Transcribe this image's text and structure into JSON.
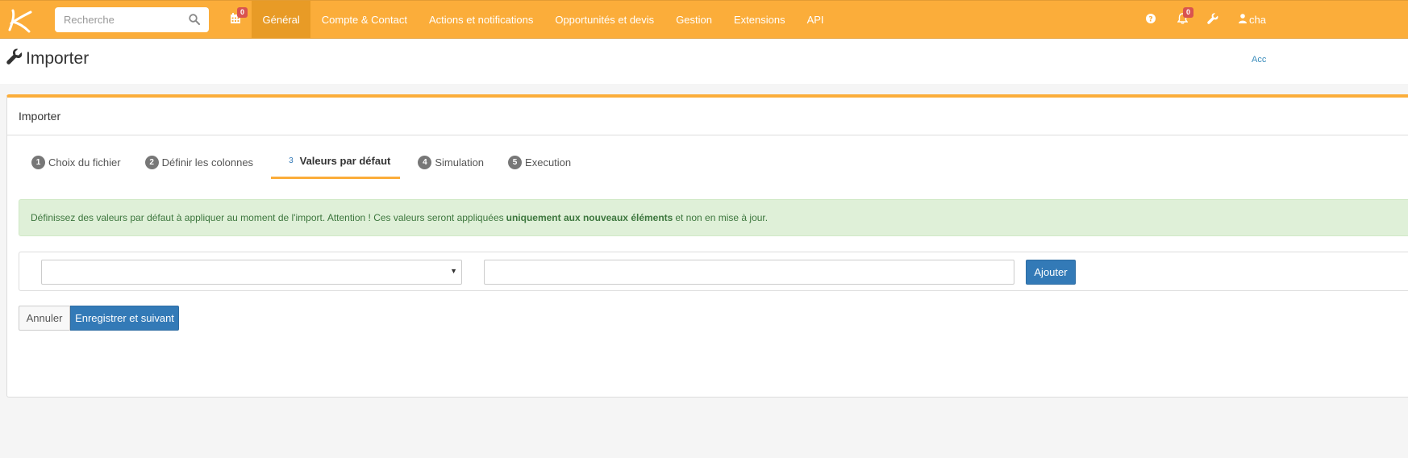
{
  "search": {
    "placeholder": "Recherche"
  },
  "navbar": {
    "calendar_badge": "0",
    "notifications_badge": "0",
    "items": [
      {
        "label": "Général",
        "active": true
      },
      {
        "label": "Compte & Contact"
      },
      {
        "label": "Actions et notifications"
      },
      {
        "label": "Opportunités et devis"
      },
      {
        "label": "Gestion"
      },
      {
        "label": "Extensions"
      },
      {
        "label": "API"
      }
    ],
    "user_label": "cha"
  },
  "header": {
    "title": "Importer",
    "right_link": "Acc"
  },
  "panel": {
    "heading": "Importer",
    "steps": [
      {
        "num": "1",
        "label": "Choix du fichier"
      },
      {
        "num": "2",
        "label": "Définir les colonnes"
      },
      {
        "num": "3",
        "label": "Valeurs par défaut",
        "active": true
      },
      {
        "num": "4",
        "label": "Simulation"
      },
      {
        "num": "5",
        "label": "Execution"
      }
    ],
    "alert": {
      "text_before": "Définissez des valeurs par défaut à appliquer au moment de l'import. Attention ! Ces valeurs seront appliquées",
      "text_bold": "uniquement aux nouveaux éléments",
      "text_after": "et non en mise à jour."
    },
    "add_button": "Ajouter",
    "cancel_button": "Annuler",
    "save_button": "Enregistrer et suivant"
  },
  "colors": {
    "navbar": "#fbad3a",
    "navbar_active": "#e89b26",
    "primary": "#337ab7",
    "alert_bg": "#dff0d8",
    "badge": "#d9534f"
  }
}
